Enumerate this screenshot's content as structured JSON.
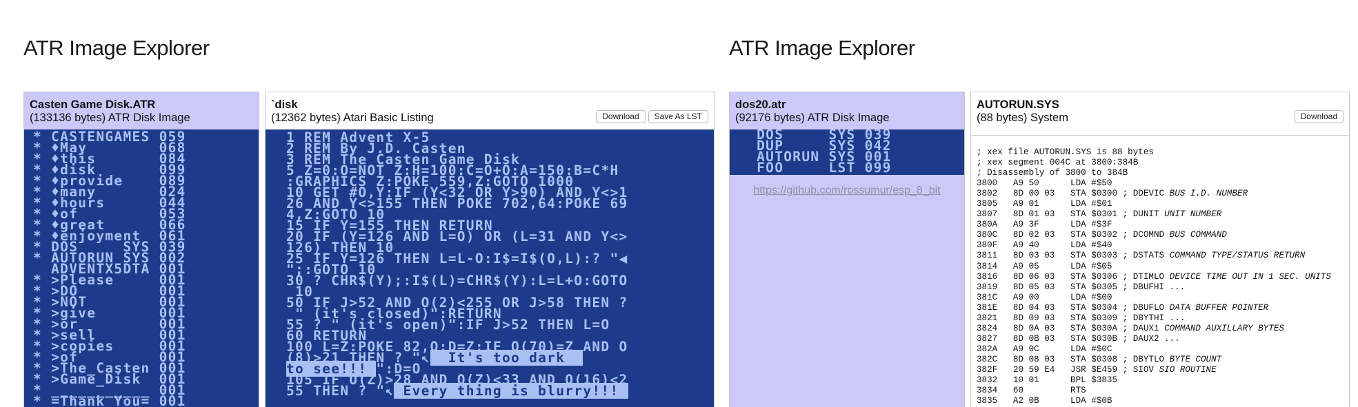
{
  "left_app": {
    "title": "ATR Image Explorer",
    "image_panel": {
      "name": "Casten Game Disk.ATR",
      "info": "(133136 bytes) ATR Disk Image",
      "entries": [
        " * CASTENGAMES 059",
        " * ♦May        068",
        " * ♦this       084",
        " * ♦disk       099",
        " * ♦provide    089",
        " * ♦many       024",
        " * ♦hours      044",
        " * ♦of         053",
        " * ♦great      066",
        " * ♦enjoyment  061",
        " * DOS     SYS 039",
        " * AUTORUN SYS 002",
        "   ADVENTX5DTA 001",
        " * >Please     001",
        " * >DO         001",
        " * >NOT        001",
        " * >give       001",
        " * >or         001",
        " * >sell       001",
        " * >copies     001",
        " * >of         001",
        " * >The_Casten 001",
        " * >Game_Disk  001",
        " * ___________ 001",
        " * =Thank_You= 001"
      ]
    },
    "file_panel": {
      "name": "`disk",
      "info": "(12362 bytes) Atari Basic Listing",
      "download_label": "Download",
      "save_lst_label": "Save As LST",
      "listing": [
        "1 REM Advent X-5",
        "2 REM By J.D. Casten",
        "3 REM The Casten Game Disk",
        "5 Z=0:O=NOT Z:H=100:C=O+O:A=150:B=C*H",
        ":GRAPHICS Z:POKE 559,Z:GOTO 1000",
        "10 GET #O,Y:IF (Y<32 OR Y>90) AND Y<>1",
        "26 AND Y<>155 THEN POKE 702,64:POKE 69",
        "4,Z:GOTO 10",
        "15 IF Y=155 THEN RETURN",
        "20 IF (Y=126 AND L=O) OR (L=31 AND Y<>",
        "126) THEN 10",
        "25 IF Y=126 THEN L=L-O:I$=I$(O,L):? \"◀",
        "\";:GOTO 10",
        "30 ? CHR$(Y);:I$(L)=CHR$(Y):L=L+O:GOTO",
        " 10",
        "50 IF J>52 AND O(2)<255 OR J>58 THEN ?",
        " \" (it's closed)\":RETURN",
        "55 ? \" (it's open)\":IF J>52 THEN L=O",
        "60 RETURN",
        "100 L=Z:POKE 82,O:D=Z:IF O(70)=Z AND O",
        "(8)>21 THEN ? \"↖",
        "to see!!!",
        "105 IF O(Z)>28 AND O(Z)<33 AND O(16)<2",
        "55 THEN ? \"↖"
      ],
      "inverse_segments": {
        "dark": "  It's too dark  ",
        "see": "to see!!! ",
        "blurry": " Every thing is blurry!!! "
      },
      "listing_tail": {
        "see": "\":D=O"
      }
    }
  },
  "right_app": {
    "title": "ATR Image Explorer",
    "image_panel": {
      "name": "dos20.atr",
      "info": "(92176 bytes) ATR Disk Image",
      "entries": [
        "   DOS     SYS 039",
        "   DUP     SYS 042",
        "   AUTORUN SYS 001",
        "   FOO     LST 099"
      ],
      "link_text": "https://github.com/rossumur/esp_8_bit"
    },
    "file_panel": {
      "name": "AUTORUN.SYS",
      "info": "(88 bytes) System",
      "download_label": "Download",
      "header_lines": [
        "; xex file AUTORUN.SYS is 88 bytes",
        "; xex segment 004C at 3800:384B",
        "; Disassembly of 3800 to 384B"
      ],
      "disassembly": [
        {
          "code": "3800   A9 50      LDA #$50",
          "comment": ""
        },
        {
          "code": "3802   8D 00 03   STA $0300 ; DDEVIC ",
          "comment": "BUS I.D. NUMBER"
        },
        {
          "code": "3805   A9 01      LDA #$01",
          "comment": ""
        },
        {
          "code": "3807   8D 01 03   STA $0301 ; DUNIT ",
          "comment": "UNIT NUMBER"
        },
        {
          "code": "380A   A9 3F      LDA #$3F",
          "comment": ""
        },
        {
          "code": "380C   8D 02 03   STA $0302 ; DCOMND ",
          "comment": "BUS COMMAND"
        },
        {
          "code": "380F   A9 40      LDA #$40",
          "comment": ""
        },
        {
          "code": "3811   8D 03 03   STA $0303 ; DSTATS ",
          "comment": "COMMAND TYPE/STATUS RETURN"
        },
        {
          "code": "3814   A9 05      LDA #$05",
          "comment": ""
        },
        {
          "code": "3816   8D 06 03   STA $0306 ; DTIMLO ",
          "comment": "DEVICE TIME OUT IN 1 SEC. UNITS"
        },
        {
          "code": "3819   8D 05 03   STA $0305 ; DBUFHI ...",
          "comment": ""
        },
        {
          "code": "381C   A9 00      LDA #$00",
          "comment": ""
        },
        {
          "code": "381E   8D 04 03   STA $0304 ; DBUFLO ",
          "comment": "DATA BUFFER POINTER"
        },
        {
          "code": "3821   8D 09 03   STA $0309 ; DBYTHI ...",
          "comment": ""
        },
        {
          "code": "3824   8D 0A 03   STA $030A ; DAUX1 ",
          "comment": "COMMAND AUXILLARY BYTES"
        },
        {
          "code": "3827   8D 0B 03   STA $030B ; DAUX2 ...",
          "comment": ""
        },
        {
          "code": "382A   A9 0C      LDA #$0C",
          "comment": ""
        },
        {
          "code": "382C   8D 08 03   STA $0308 ; DBYTLO ",
          "comment": "BYTE COUNT"
        },
        {
          "code": "382F   20 59 E4   JSR $E459 ; SIOV ",
          "comment": "SIO ROUTINE"
        },
        {
          "code": "3832   10 01      BPL $3835",
          "comment": ""
        },
        {
          "code": "3834   60         RTS",
          "comment": ""
        },
        {
          "code": "3835   A2 0B      LDA #$0B",
          "comment": ""
        }
      ]
    }
  },
  "colors": {
    "atari_bg": "#1d3b8a",
    "atari_fg": "#a9c0f3",
    "panel_lavender": "#ccc9f8"
  }
}
